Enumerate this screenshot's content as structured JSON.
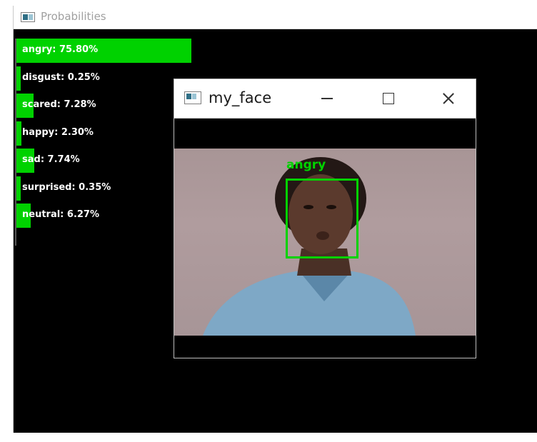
{
  "probabilities_window": {
    "title": "Probabilities",
    "rows": [
      {
        "label": "angry: 75.80%",
        "value": 75.8
      },
      {
        "label": "disgust: 0.25%",
        "value": 0.25
      },
      {
        "label": "scared: 7.28%",
        "value": 7.28
      },
      {
        "label": "happy: 2.30%",
        "value": 2.3
      },
      {
        "label": "sad: 7.74%",
        "value": 7.74
      },
      {
        "label": "surprised: 0.35%",
        "value": 0.35
      },
      {
        "label": "neutral: 6.27%",
        "value": 6.27
      }
    ],
    "bar_color": "#00d200"
  },
  "face_window": {
    "title": "my_face",
    "detected_label": "angry",
    "box_color": "#00d200"
  }
}
